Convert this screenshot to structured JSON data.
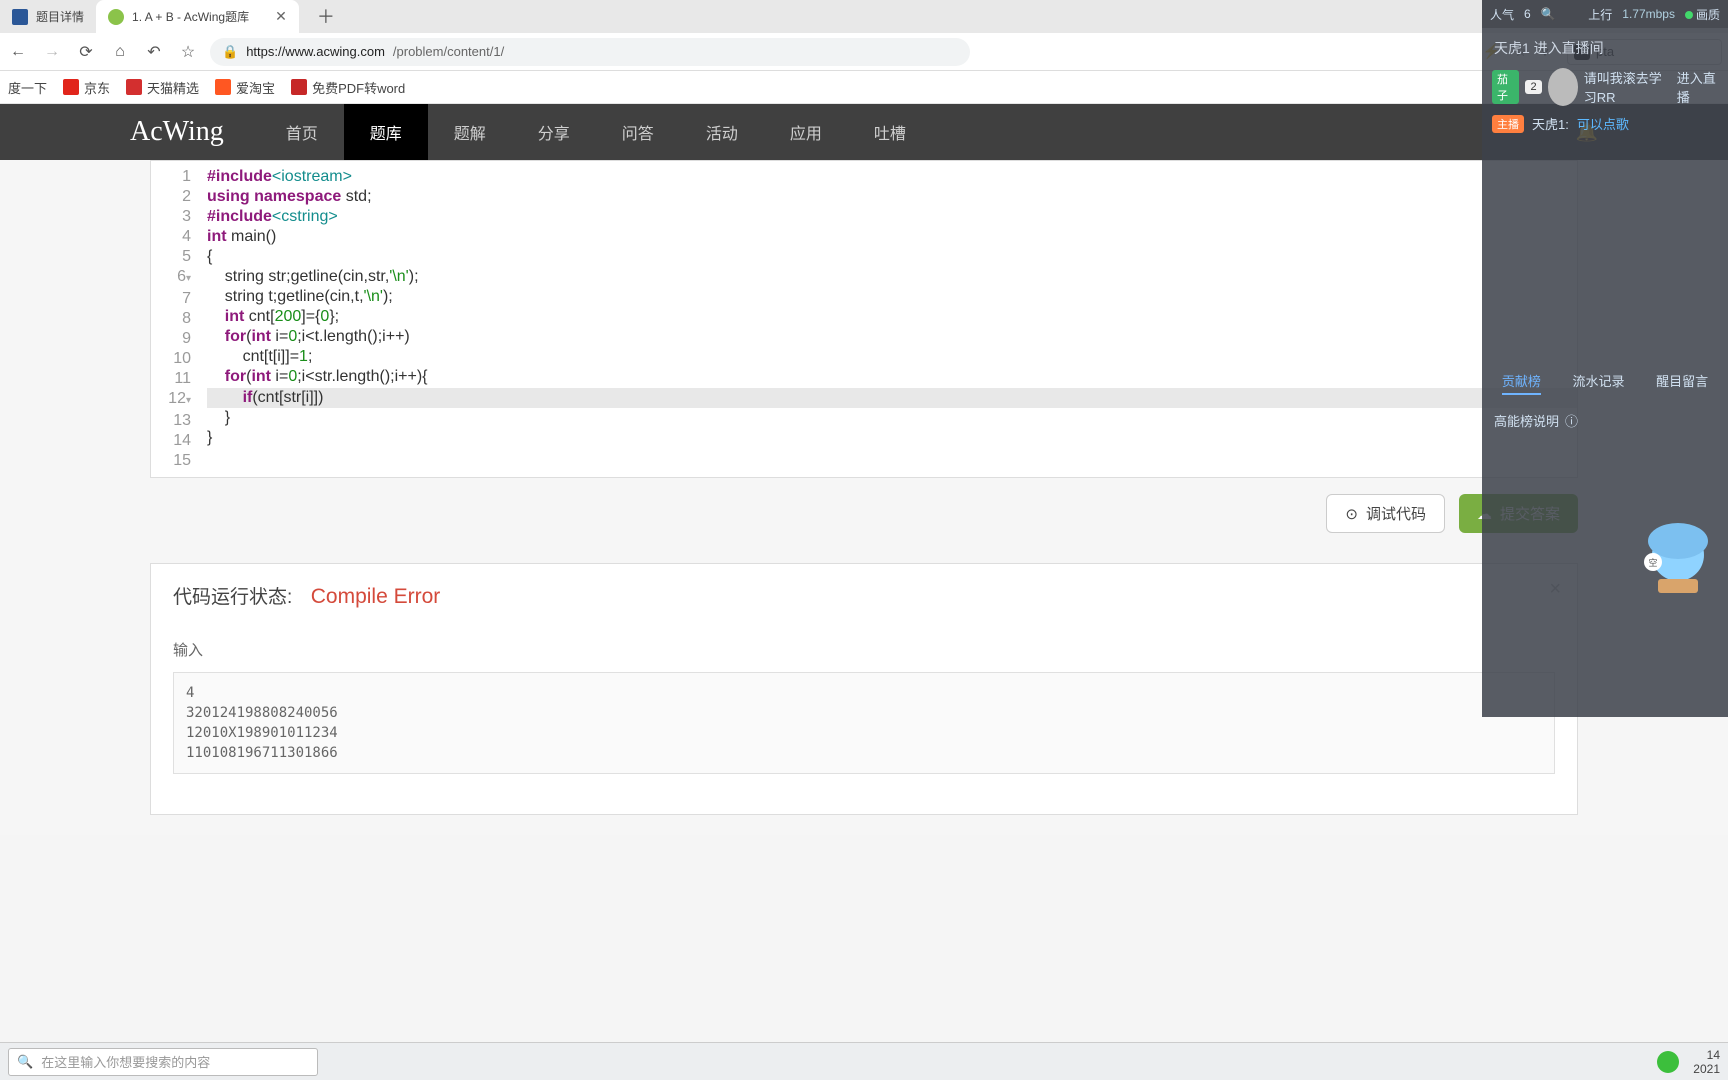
{
  "tabs": [
    {
      "label": "题目详情"
    },
    {
      "label": "1. A + B - AcWing题库"
    }
  ],
  "url": {
    "scheme_host": "https://www.acwing.com",
    "path": "/problem/content/1/"
  },
  "ext_search": "pta",
  "bookmarks": [
    "度一下",
    "京东",
    "天猫精选",
    "爱淘宝",
    "免费PDF转word"
  ],
  "sitenav": {
    "logo": "AcWing",
    "links": [
      "首页",
      "题库",
      "题解",
      "分享",
      "问答",
      "活动",
      "应用",
      "吐槽"
    ],
    "active_index": 1
  },
  "code": {
    "gutter": [
      "1",
      "2",
      "3",
      "4",
      "5",
      "6",
      "7",
      "8",
      "9",
      "10",
      "11",
      "12",
      "13",
      "14",
      "15"
    ],
    "lines": [
      {
        "segs": [
          {
            "t": "#include",
            "c": "kw"
          },
          {
            "t": "<iostream>",
            "c": "system"
          }
        ]
      },
      {
        "segs": [
          {
            "t": "using ",
            "c": "kw"
          },
          {
            "t": "namespace",
            "c": "typ"
          },
          {
            "t": " std;",
            "c": "fn"
          }
        ]
      },
      {
        "segs": [
          {
            "t": "#include",
            "c": "kw"
          },
          {
            "t": "<cstring>",
            "c": "system"
          }
        ]
      },
      {
        "segs": [
          {
            "t": "",
            "c": "fn"
          }
        ]
      },
      {
        "segs": [
          {
            "t": "int ",
            "c": "typ"
          },
          {
            "t": "main()",
            "c": "fn"
          }
        ]
      },
      {
        "segs": [
          {
            "t": "{",
            "c": "fn"
          }
        ]
      },
      {
        "segs": [
          {
            "t": "    string str;getline(cin,str,",
            "c": "fn"
          },
          {
            "t": "'\\n'",
            "c": "str"
          },
          {
            "t": ");",
            "c": "fn"
          }
        ]
      },
      {
        "segs": [
          {
            "t": "    string t;getline(cin,t,",
            "c": "fn"
          },
          {
            "t": "'\\n'",
            "c": "str"
          },
          {
            "t": ");",
            "c": "fn"
          }
        ]
      },
      {
        "segs": [
          {
            "t": "    ",
            "c": "fn"
          },
          {
            "t": "int",
            "c": "typ"
          },
          {
            "t": " cnt[",
            "c": "fn"
          },
          {
            "t": "200",
            "c": "num"
          },
          {
            "t": "]={",
            "c": "fn"
          },
          {
            "t": "0",
            "c": "num"
          },
          {
            "t": "};",
            "c": "fn"
          }
        ]
      },
      {
        "segs": [
          {
            "t": "    ",
            "c": "fn"
          },
          {
            "t": "for",
            "c": "kw"
          },
          {
            "t": "(",
            "c": "fn"
          },
          {
            "t": "int",
            "c": "typ"
          },
          {
            "t": " i=",
            "c": "fn"
          },
          {
            "t": "0",
            "c": "num"
          },
          {
            "t": ";i<t.length();i++)",
            "c": "fn"
          }
        ]
      },
      {
        "segs": [
          {
            "t": "        cnt[t[i]]=",
            "c": "fn"
          },
          {
            "t": "1",
            "c": "num"
          },
          {
            "t": ";",
            "c": "fn"
          }
        ]
      },
      {
        "segs": [
          {
            "t": "    ",
            "c": "fn"
          },
          {
            "t": "for",
            "c": "kw"
          },
          {
            "t": "(",
            "c": "fn"
          },
          {
            "t": "int",
            "c": "typ"
          },
          {
            "t": " i=",
            "c": "fn"
          },
          {
            "t": "0",
            "c": "num"
          },
          {
            "t": ";i<str.length();i++){",
            "c": "fn"
          }
        ]
      },
      {
        "hl": true,
        "segs": [
          {
            "t": "        ",
            "c": "fn"
          },
          {
            "t": "if",
            "c": "kw"
          },
          {
            "t": "(cnt[str[i]])",
            "c": "fn"
          }
        ]
      },
      {
        "segs": [
          {
            "t": "    }",
            "c": "fn"
          }
        ]
      },
      {
        "segs": [
          {
            "t": "}",
            "c": "fn"
          }
        ]
      }
    ]
  },
  "actions": {
    "debug": "调试代码",
    "submit": "提交答案"
  },
  "status": {
    "label": "代码运行状态:",
    "value": "Compile Error",
    "input_label": "输入",
    "input_text": "4\n320124198808240056\n12010X198901011234\n110108196711301866"
  },
  "overlay": {
    "popularity_label": "人气",
    "popularity_value": "6",
    "uplink_label": "上行",
    "bandwidth": "1.77mbps",
    "quality": "画质",
    "join_msg": "天虎1 进入直播间",
    "guest_badge": "茄子",
    "guest_count": "2",
    "guest_name": "请叫我滚去学习RR",
    "guest_action": "进入直播",
    "host_badge": "主播",
    "host_name": "天虎1:",
    "host_link": "可以点歌",
    "tabs": [
      "贡献榜",
      "流水记录",
      "醒目留言"
    ],
    "explain": "高能榜说明"
  },
  "os": {
    "search_placeholder": "在这里输入你想要搜索的内容",
    "time": "14",
    "date": "2021"
  }
}
